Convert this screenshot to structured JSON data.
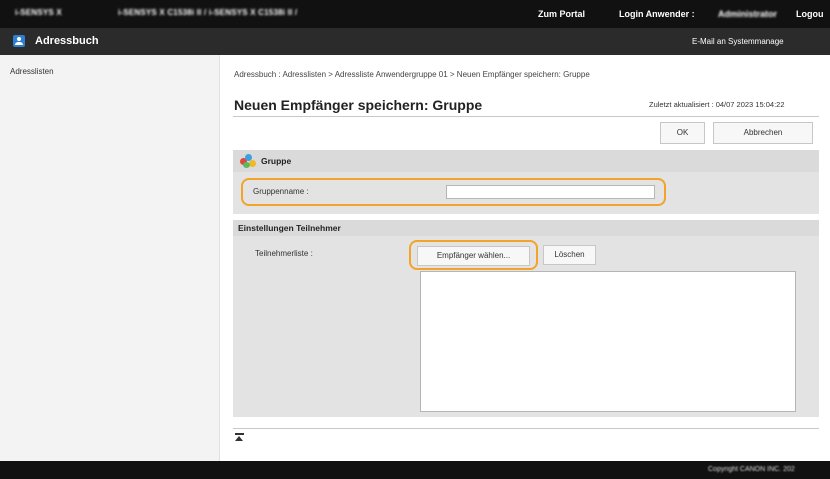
{
  "header": {
    "model_name": "i-SENSYS X",
    "model_path": "i-SENSYS X C1538i II / i-SENSYS X C1538i II /",
    "portal_link": "Zum Portal",
    "login_label": "Login Anwender :",
    "login_user": "Administrator",
    "logout": "Logou"
  },
  "app_bar": {
    "title": "Adressbuch",
    "mail_admin": "E-Mail an Systemmanage"
  },
  "sidebar": {
    "items": [
      {
        "label": "Adresslisten"
      }
    ]
  },
  "main": {
    "breadcrumb": "Adressbuch : Adresslisten > Adressliste Anwendergruppe 01 > Neuen Empfänger speichern: Gruppe",
    "page_title": "Neuen Empfänger speichern: Gruppe",
    "last_updated": "Zuletzt aktualisiert : 04/07 2023 15:04:22",
    "ok_label": "OK",
    "cancel_label": "Abbrechen",
    "group_section": {
      "title": "Gruppe",
      "group_name_label": "Gruppenname :",
      "group_name_value": ""
    },
    "members_section": {
      "title": "Einstellungen Teilnehmer",
      "list_label": "Teilnehmerliste :",
      "choose_label": "Empfänger wählen...",
      "delete_label": "Löschen",
      "members": []
    }
  },
  "footer": {
    "copyright": "Copyright CANON INC. 202"
  },
  "colors": {
    "highlight": "#f2a42a",
    "top_bar": "#111111",
    "app_bar": "#2b2b2b",
    "app_icon": "#2f7fd0"
  },
  "icons": {
    "app": "address-book-icon",
    "group": "group-icon",
    "back_to_top": "back-to-top-icon"
  }
}
